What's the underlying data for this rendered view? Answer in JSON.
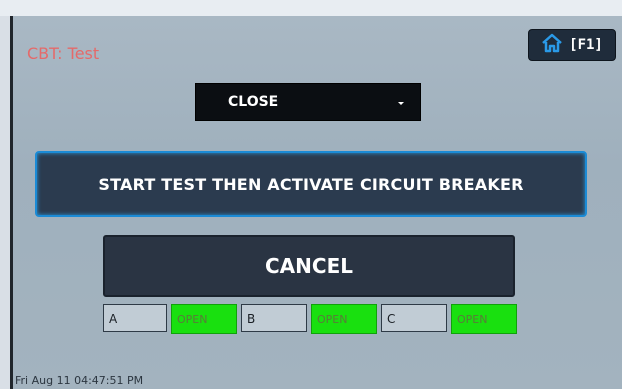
{
  "screen": {
    "title": "CBT: Test",
    "home_key_label": "[F1]"
  },
  "dropdown": {
    "selected": "CLOSE"
  },
  "buttons": {
    "start": "START TEST THEN ACTIVATE CIRCUIT BREAKER",
    "cancel": "CANCEL"
  },
  "phases": [
    {
      "label": "A",
      "status": "OPEN"
    },
    {
      "label": "B",
      "status": "OPEN"
    },
    {
      "label": "C",
      "status": "OPEN"
    }
  ],
  "footer": {
    "datetime": "Fri Aug 11  04:47:51 PM"
  },
  "colors": {
    "status_open": "#19e00f",
    "title": "#e46a6a",
    "accent_border": "#1b8bd6"
  },
  "icons": {
    "home": "home-icon",
    "dropdown": "chevron-down-icon"
  }
}
